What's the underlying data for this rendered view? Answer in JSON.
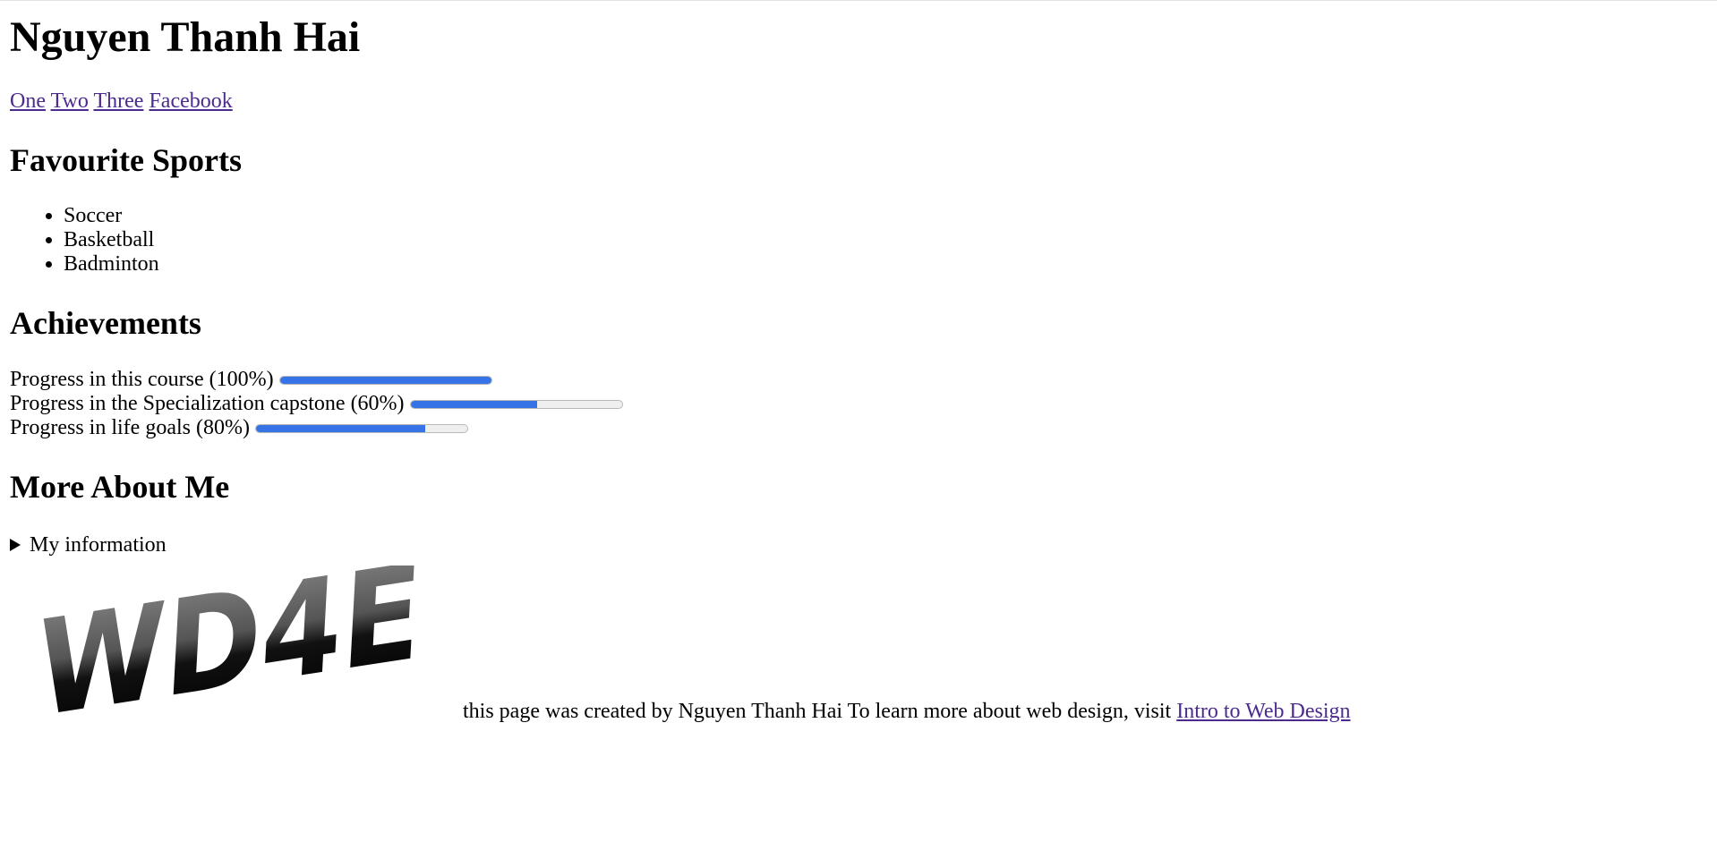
{
  "header": {
    "title": "Nguyen Thanh Hai"
  },
  "nav": {
    "links": [
      "One",
      "Two",
      "Three",
      "Facebook"
    ]
  },
  "sports": {
    "heading": "Favourite Sports",
    "items": [
      "Soccer",
      "Basketball",
      "Badminton"
    ]
  },
  "achievements": {
    "heading": "Achievements",
    "items": [
      {
        "label": "Progress in this course (100%)",
        "value": 1.0
      },
      {
        "label": "Progress in the Specialization capstone (60%)",
        "value": 0.6
      },
      {
        "label": "Progress in life goals (80%)",
        "value": 0.8
      }
    ],
    "fill_color": "#3573e6"
  },
  "more": {
    "heading": "More About Me",
    "details_summary": "My information"
  },
  "footer": {
    "logo_text": "WD4E",
    "text": "this page was created by Nguyen Thanh Hai To learn more about web design, visit",
    "link": "Intro to Web Design"
  }
}
